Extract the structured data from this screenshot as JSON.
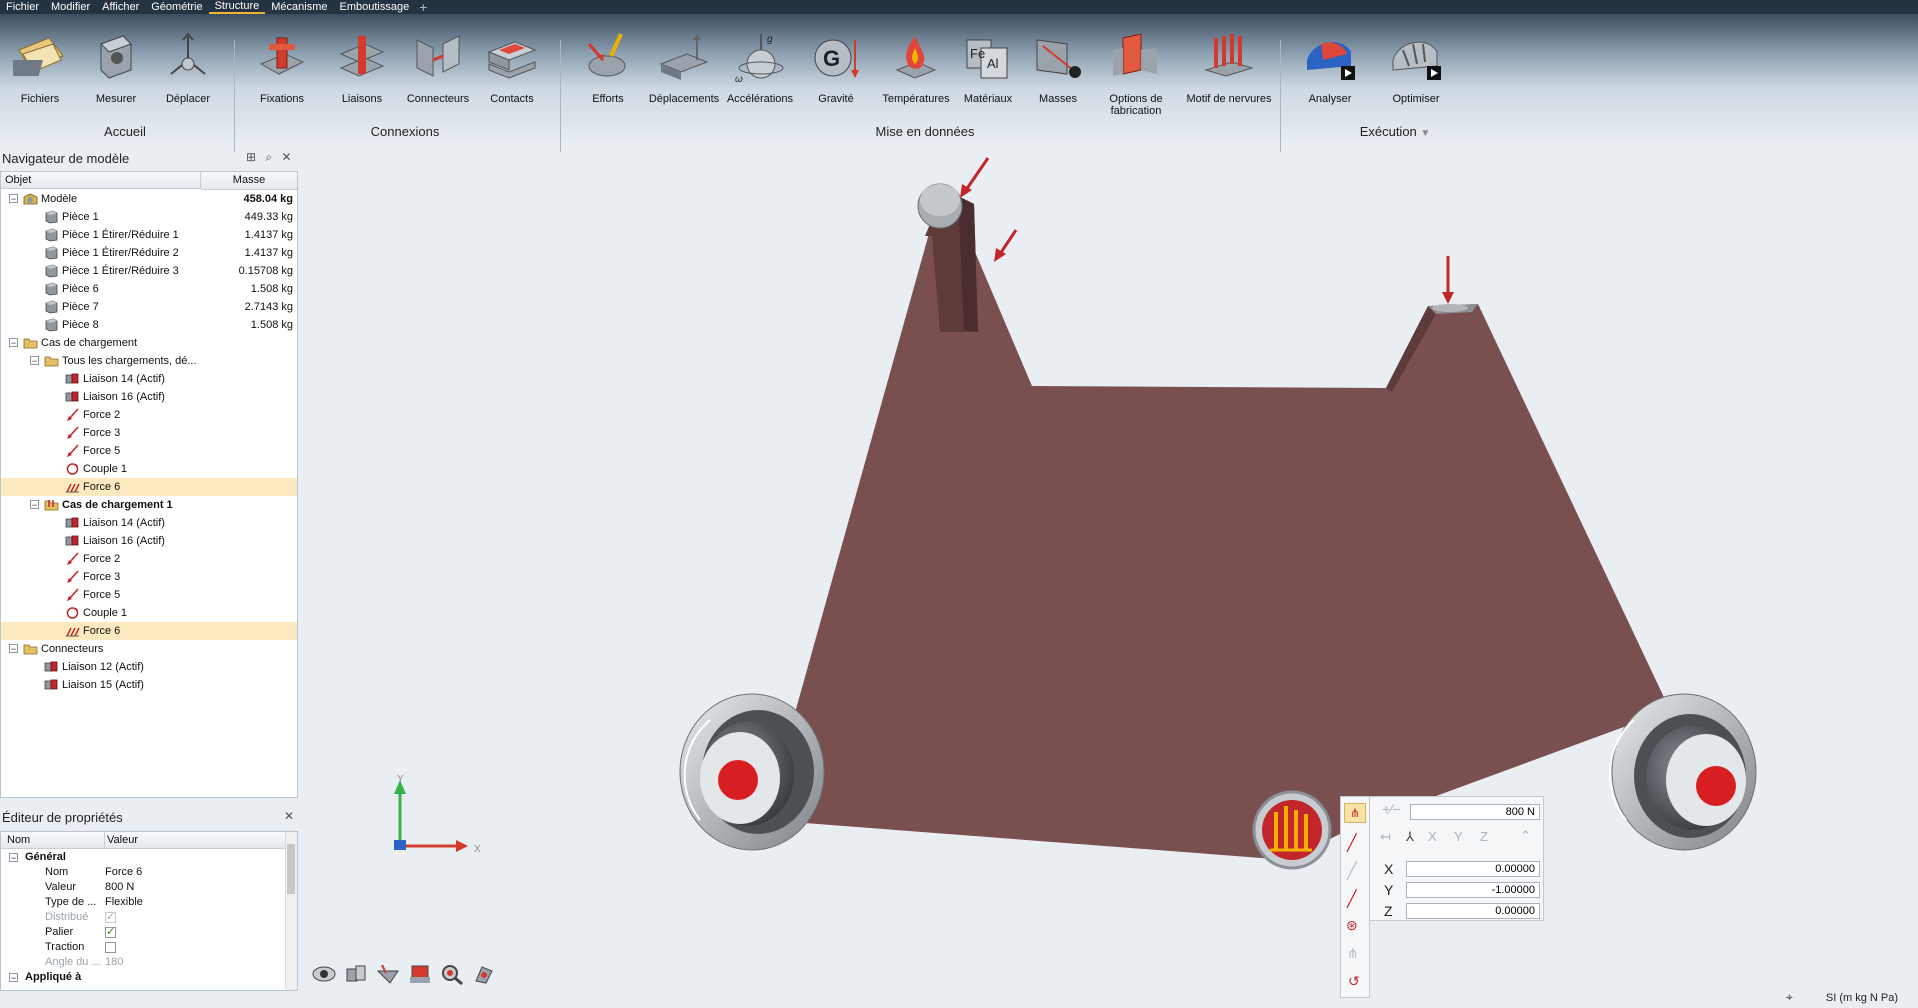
{
  "menu": [
    "Fichier",
    "Modifier",
    "Afficher",
    "Géométrie",
    "Structure",
    "Mécanisme",
    "Emboutissage"
  ],
  "menu_active": "Structure",
  "ribbon": {
    "accueil": {
      "label": "Accueil",
      "buttons": [
        "Fichiers",
        "Mesurer",
        "Déplacer"
      ]
    },
    "connexions": {
      "label": "Connexions",
      "buttons": [
        "Fixations",
        "Liaisons",
        "Connecteurs",
        "Contacts"
      ]
    },
    "mise": {
      "label": "Mise en données",
      "buttons": [
        "Efforts",
        "Déplacements",
        "Accélérations",
        "Gravité",
        "Températures",
        "Matériaux",
        "Masses",
        "Options de fabrication",
        "Motif de nervures"
      ]
    },
    "execution": {
      "label": "Exécution",
      "buttons": [
        "Analyser",
        "Optimiser"
      ]
    }
  },
  "navigator": {
    "title": "Navigateur de modèle",
    "col_object": "Objet",
    "col_mass": "Masse",
    "rows": [
      {
        "label": "Modèle",
        "value": "458.04 kg",
        "level": 0,
        "toggle": "−",
        "icon": "model-icon",
        "bold_value": true
      },
      {
        "label": "Pièce 1",
        "value": "449.33 kg",
        "level": 1,
        "icon": "part-icon"
      },
      {
        "label": "Pièce 1 Étirer/Réduire 1",
        "value": "1.4137 kg",
        "level": 1,
        "icon": "part-icon"
      },
      {
        "label": "Pièce 1 Étirer/Réduire 2",
        "value": "1.4137 kg",
        "level": 1,
        "icon": "part-icon"
      },
      {
        "label": "Pièce 1 Étirer/Réduire 3",
        "value": "0.15708 kg",
        "level": 1,
        "icon": "part-icon"
      },
      {
        "label": "Pièce 6",
        "value": "1.508 kg",
        "level": 1,
        "icon": "part-icon"
      },
      {
        "label": "Pièce 7",
        "value": "2.7143 kg",
        "level": 1,
        "icon": "part-icon"
      },
      {
        "label": "Pièce 8",
        "value": "1.508 kg",
        "level": 1,
        "icon": "part-icon"
      },
      {
        "label": "Cas de chargement",
        "value": "",
        "level": 0,
        "toggle": "−",
        "icon": "folder-icon"
      },
      {
        "label": "Tous les chargements, dé...",
        "value": "",
        "level": 1,
        "toggle": "−",
        "icon": "folder-icon"
      },
      {
        "label": "Liaison 14 (Actif)",
        "value": "",
        "level": 2,
        "icon": "joint-icon"
      },
      {
        "label": "Liaison 16 (Actif)",
        "value": "",
        "level": 2,
        "icon": "joint-icon"
      },
      {
        "label": "Force 2",
        "value": "",
        "level": 2,
        "icon": "force-icon"
      },
      {
        "label": "Force 3",
        "value": "",
        "level": 2,
        "icon": "force-icon"
      },
      {
        "label": "Force 5",
        "value": "",
        "level": 2,
        "icon": "force-icon"
      },
      {
        "label": "Couple 1",
        "value": "",
        "level": 2,
        "icon": "torque-icon"
      },
      {
        "label": "Force 6",
        "value": "",
        "level": 2,
        "icon": "distributed-force-icon",
        "selected": true
      },
      {
        "label": "Cas de chargement 1",
        "value": "",
        "level": 1,
        "toggle": "−",
        "icon": "loadcase-icon",
        "bold_label": true
      },
      {
        "label": "Liaison 14 (Actif)",
        "value": "",
        "level": 2,
        "icon": "joint-icon"
      },
      {
        "label": "Liaison 16 (Actif)",
        "value": "",
        "level": 2,
        "icon": "joint-icon"
      },
      {
        "label": "Force 2",
        "value": "",
        "level": 2,
        "icon": "force-icon"
      },
      {
        "label": "Force 3",
        "value": "",
        "level": 2,
        "icon": "force-icon"
      },
      {
        "label": "Force 5",
        "value": "",
        "level": 2,
        "icon": "force-icon"
      },
      {
        "label": "Couple 1",
        "value": "",
        "level": 2,
        "icon": "torque-icon"
      },
      {
        "label": "Force 6",
        "value": "",
        "level": 2,
        "icon": "distributed-force-icon",
        "selected": true
      },
      {
        "label": "Connecteurs",
        "value": "",
        "level": 0,
        "toggle": "−",
        "icon": "folder-icon"
      },
      {
        "label": "Liaison 12 (Actif)",
        "value": "",
        "level": 1,
        "icon": "joint-icon"
      },
      {
        "label": "Liaison 15 (Actif)",
        "value": "",
        "level": 1,
        "icon": "joint-icon"
      }
    ]
  },
  "properties": {
    "title": "Éditeur de propriétés",
    "col_name": "Nom",
    "col_value": "Valeur",
    "section_general": "Général",
    "rows": [
      {
        "name": "Nom",
        "value": "Force 6",
        "type": "text"
      },
      {
        "name": "Valeur",
        "value": "800 N",
        "type": "text"
      },
      {
        "name": "Type de ...",
        "value": "Flexible",
        "type": "text"
      },
      {
        "name": "Distribué",
        "value": "",
        "type": "check",
        "checked": true,
        "disabled": true
      },
      {
        "name": "Palier",
        "value": "",
        "type": "check",
        "checked": true
      },
      {
        "name": "Traction",
        "value": "",
        "type": "check",
        "checked": false
      },
      {
        "name": "Angle du ...",
        "value": "180",
        "type": "text",
        "disabled": true
      }
    ],
    "section_applied": "Appliqué à"
  },
  "force_popup": {
    "magnitude": "800 N",
    "axes": [
      "X",
      "Y",
      "Z"
    ],
    "x": "0.00000",
    "y": "-1.00000",
    "z": "0.00000",
    "label_x": "X",
    "label_y": "Y",
    "label_z": "Z"
  },
  "axis_triad": {
    "y": "Y",
    "x": "X"
  },
  "status": {
    "units": "SI (m kg N Pa)"
  },
  "colors": {
    "frame": "#7a4f50",
    "force_arrow": "#c0262a",
    "support_red": "#d81e20",
    "selection": "#fce9c0"
  }
}
